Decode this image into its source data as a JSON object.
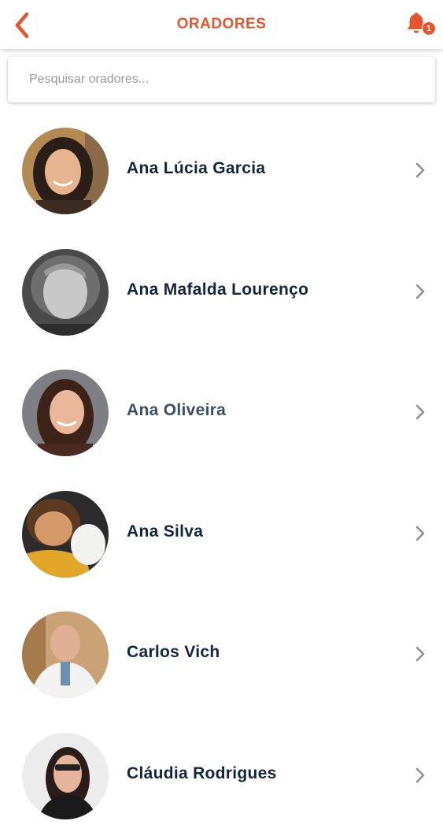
{
  "header": {
    "title": "ORADORES",
    "notification_count": "1",
    "accent_color": "#e4572e"
  },
  "search": {
    "placeholder": "Pesquisar oradores..."
  },
  "speakers": [
    {
      "name": "Ana Lúcia Garcia"
    },
    {
      "name": "Ana Mafalda Lourenço"
    },
    {
      "name": "Ana Oliveira"
    },
    {
      "name": "Ana Silva"
    },
    {
      "name": "Carlos Vich"
    },
    {
      "name": "Cláudia Rodrigues"
    }
  ]
}
